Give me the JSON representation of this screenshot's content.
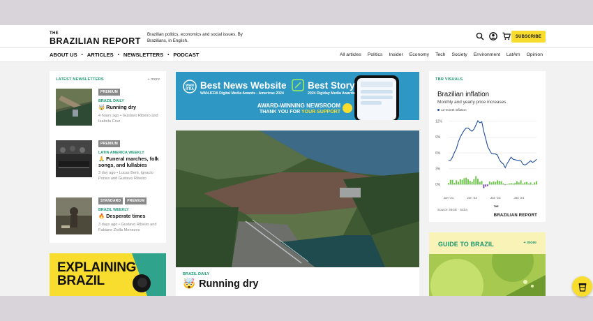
{
  "header": {
    "logo_the": "THE",
    "logo_name": "BRAZILIAN REPORT",
    "tagline": "Brazilian politics, economics and social issues. By Brazilians, in English.",
    "subscribe_label": "SUBSCRIBE",
    "icons": [
      "search-icon",
      "user-icon",
      "cart-icon"
    ]
  },
  "nav": {
    "main": [
      "ABOUT US",
      "ARTICLES",
      "NEWSLETTERS",
      "PODCAST"
    ],
    "separator": "•",
    "sections": [
      "All articles",
      "Politics",
      "Insider",
      "Economy",
      "Tech",
      "Society",
      "Environment",
      "LatAm",
      "Opinion"
    ]
  },
  "newsletters": {
    "heading": "LATEST NEWSLETTERS",
    "more": "+ more",
    "items": [
      {
        "tags": [
          "PREMIUM"
        ],
        "kicker": "BRAZIL DAILY",
        "icon": "🤯",
        "title": "Running dry",
        "meta": "4 hours ago • Gustavo Ribeiro and Isabela Cruz"
      },
      {
        "tags": [
          "PREMIUM"
        ],
        "kicker": "LATIN AMERICA WEEKLY",
        "icon": "🙏",
        "title": "Funeral marches, folk songs, and lullabies",
        "meta": "3 day ago • Lucas Berti, Ignacio Portes and Gustavo Ribeiro"
      },
      {
        "tags": [
          "STANDARD",
          "PREMIUM"
        ],
        "kicker": "BRAZIL WEEKLY",
        "icon": "🔥",
        "title": "Desperate times",
        "meta": "3 days ago • Gustavo Ribeiro and Fabiane Ziolla Menezes"
      }
    ]
  },
  "explaining": {
    "line1": "EXPLAINING",
    "line2": "BRAZIL"
  },
  "awards_banner": {
    "award1_title": "Best News Website",
    "award1_sub": "WAN-IFRA Digital Media Awards - Americas 2024",
    "award2_title": "Best Story",
    "award2_sub": "2024 Digiday Media Awards",
    "line1": "AWARD-WINNING NEWSROOM",
    "line2_a": "THANK YOU FOR ",
    "line2_b": "YOUR SUPPORT",
    "badge_wan": "WAN IFRA"
  },
  "featured": {
    "kicker": "BRAZIL DAILY",
    "icon": "🤯",
    "title": "Running dry"
  },
  "visuals": {
    "heading": "TBR VISUALS",
    "title": "Brazilian inflation",
    "subtitle": "Monthly and yearly price increases",
    "legend": "12-month inflation",
    "source": "Source: IBGE · Sidra",
    "brand_the": "THE",
    "brand_name": "BRAZILIAN REPORT"
  },
  "chart_data": {
    "type": "line",
    "title": "Brazilian inflation",
    "subtitle": "Monthly and yearly price increases",
    "y_ticks": [
      "12%",
      "9%",
      "6%",
      "3%",
      "0%"
    ],
    "x_ticks": [
      "Jan '21",
      "Jan '22",
      "Jan '23",
      "Jan '24"
    ],
    "ylim": [
      -1,
      12.5
    ],
    "series": [
      {
        "name": "12-month inflation",
        "color": "#1f4e9b",
        "values": [
          4.6,
          4.6,
          5.2,
          6.1,
          6.8,
          8.1,
          9.0,
          9.7,
          10.3,
          10.7,
          10.7,
          10.4,
          10.1,
          10.5,
          11.3,
          12.1,
          11.7,
          11.9,
          10.1,
          8.7,
          7.2,
          6.5,
          5.9,
          5.8,
          5.8,
          5.6,
          4.7,
          4.2,
          3.9,
          3.2,
          4.0,
          4.6,
          5.2,
          4.8,
          4.7,
          4.6,
          4.5,
          4.5,
          3.9,
          3.7,
          3.9,
          4.2,
          4.5,
          4.2,
          4.4,
          4.8
        ]
      },
      {
        "name": "Monthly inflation",
        "color": "#6ec74c",
        "negative_color": "#7b4fa6",
        "values": [
          0.3,
          0.9,
          0.9,
          0.3,
          0.8,
          0.5,
          1.0,
          0.9,
          1.2,
          1.3,
          1.0,
          0.7,
          0.5,
          1.0,
          1.6,
          1.1,
          0.5,
          0.7,
          -0.7,
          -0.4,
          -0.3,
          0.6,
          0.4,
          0.6,
          0.5,
          0.8,
          0.7,
          0.6,
          0.2,
          -0.1,
          0.1,
          0.2,
          0.3,
          0.2,
          0.3,
          0.6,
          0.4,
          0.8,
          0.2,
          0.4,
          0.5,
          0.2,
          0.4,
          0.0,
          0.4,
          0.6
        ]
      }
    ]
  },
  "guide": {
    "title": "GUIDE TO BRAZIL",
    "more": "+ more"
  }
}
